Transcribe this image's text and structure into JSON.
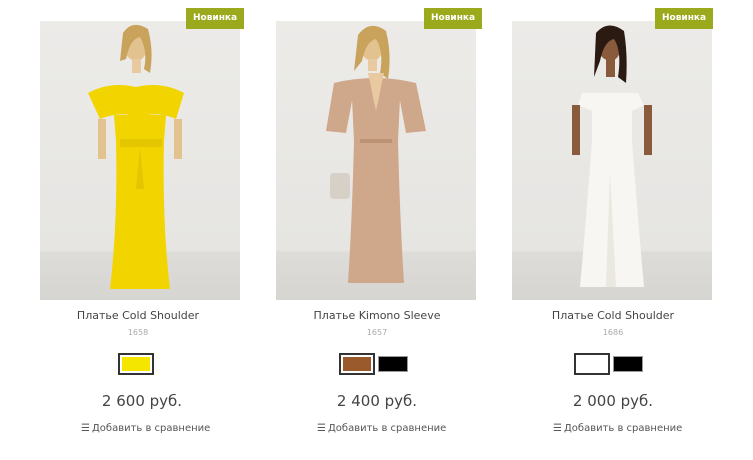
{
  "products": [
    {
      "badge": "Новинка",
      "title": "Платье Cold Shoulder",
      "sku": "1658",
      "swatches": [
        {
          "color": "#f5e600",
          "selected": true
        }
      ],
      "price": "2 600 руб.",
      "compare_label": "Добавить в сравнение",
      "dress_color": "#f2d400"
    },
    {
      "badge": "Новинка",
      "title": "Платье Kimono Sleeve",
      "sku": "1657",
      "swatches": [
        {
          "color": "#9a5a2c",
          "selected": true
        },
        {
          "color": "#000000",
          "selected": false
        }
      ],
      "price": "2 400 руб.",
      "compare_label": "Добавить в сравнение",
      "dress_color": "#cfa88c"
    },
    {
      "badge": "Новинка",
      "title": "Платье Cold Shoulder",
      "sku": "1686",
      "swatches": [
        {
          "color": "#ffffff",
          "selected": true
        },
        {
          "color": "#000000",
          "selected": false
        }
      ],
      "price": "2 000 руб.",
      "compare_label": "Добавить в сравнение",
      "dress_color": "#f7f6f2"
    }
  ]
}
